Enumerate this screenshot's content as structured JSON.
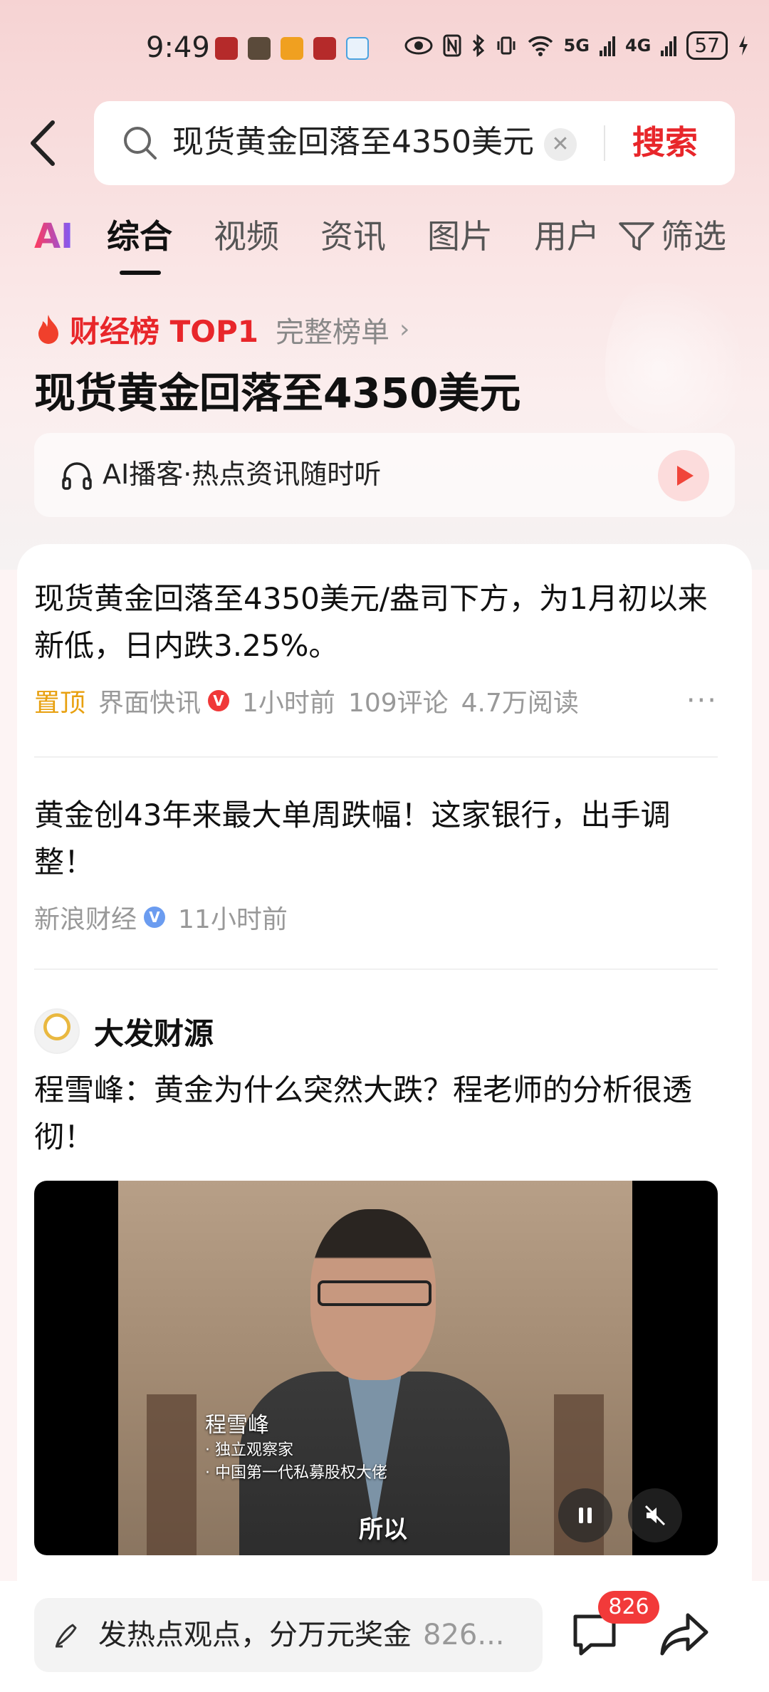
{
  "status_bar": {
    "time": "9:49",
    "network1": "5G",
    "network2": "4G",
    "battery": "57"
  },
  "search": {
    "query": "现货黄金回落至4350美元",
    "clear_icon": "close-icon",
    "submit_label": "搜索"
  },
  "tabs": {
    "ai": "AI",
    "items": [
      "综合",
      "视频",
      "资讯",
      "图片",
      "用户"
    ],
    "active": "综合",
    "filter": "筛选"
  },
  "trending": {
    "rank_label": "财经榜 TOP1",
    "full_list": "完整榜单",
    "topic_title": "现货黄金回落至4350美元",
    "podcast": "AI播客·热点资讯随时听"
  },
  "feed": {
    "article1": {
      "title": "现货黄金回落至4350美元/盎司下方，为1月初以来新低，日内跌3.25%。",
      "pin": "置顶",
      "source": "界面快讯",
      "verified_mark": "V",
      "time": "1小时前",
      "comments": "109评论",
      "reads": "4.7万阅读",
      "more": "···"
    },
    "article2": {
      "title": "黄金创43年来最大单周跌幅！这家银行，出手调整！",
      "source": "新浪财经",
      "verified_mark": "V",
      "time": "11小时前"
    },
    "post": {
      "author": "大发财源",
      "text": "程雪峰：黄金为什么突然大跌？程老师的分析很透彻！",
      "video": {
        "caption_name": "程雪峰",
        "caption_role1": "· 独立观察家",
        "caption_role2": "· 中国第一代私募股权大佬",
        "subtitle": "所以"
      }
    }
  },
  "bottom_bar": {
    "comment_placeholder": "发热点观点，分万元奖金",
    "comment_count_inline": "826...",
    "comment_badge": "826"
  },
  "colors": {
    "accent_red": "#e8262a",
    "pin_orange": "#e8a00f",
    "verified_red": "#f03838",
    "verified_blue": "#6b9cf0"
  }
}
